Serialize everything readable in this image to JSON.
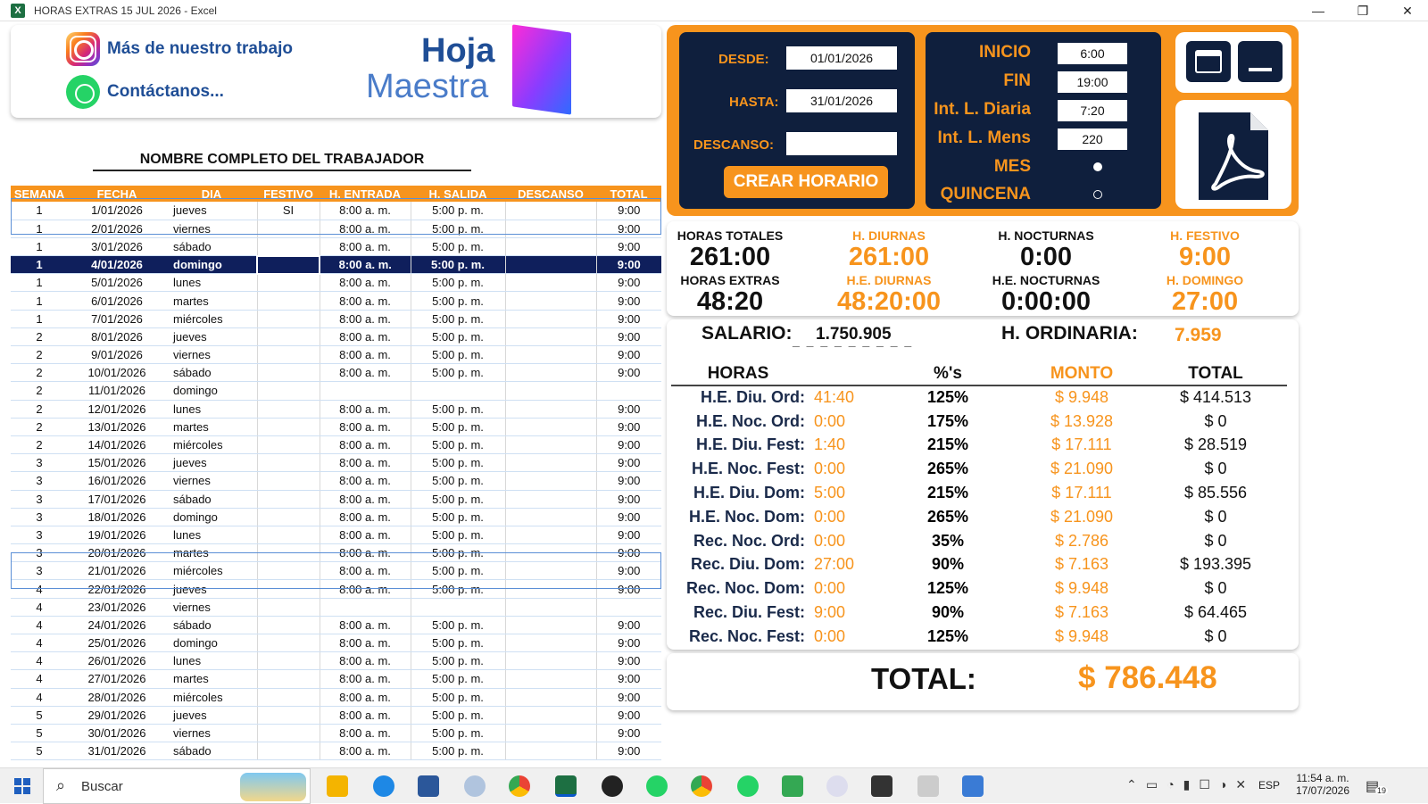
{
  "window": {
    "title": "HORAS EXTRAS 15 JUL 2026 - Excel",
    "min": "—",
    "max": "❐",
    "close": "✕",
    "app_icon": "X"
  },
  "links": {
    "instagram": "Más de nuestro trabajo",
    "whatsapp": "Contáctanos..."
  },
  "logo": {
    "line1": "Hoja",
    "line2": "Maestra"
  },
  "worker_name": "NOMBRE COMPLETO DEL TRABAJADOR",
  "table": {
    "headers": [
      "SEMANA",
      "FECHA",
      "DIA",
      "FESTIVO",
      "H. ENTRADA",
      "H. SALIDA",
      "DESCANSO",
      "TOTAL"
    ],
    "rows": [
      [
        "1",
        "1/01/2026",
        "jueves",
        "SI",
        "8:00 a. m.",
        "5:00 p. m.",
        "",
        "9:00"
      ],
      [
        "1",
        "2/01/2026",
        "viernes",
        "",
        "8:00 a. m.",
        "5:00 p. m.",
        "",
        "9:00"
      ],
      [
        "1",
        "3/01/2026",
        "sábado",
        "",
        "8:00 a. m.",
        "5:00 p. m.",
        "",
        "9:00"
      ],
      [
        "1",
        "4/01/2026",
        "domingo",
        "",
        "8:00 a. m.",
        "5:00 p. m.",
        "",
        "9:00"
      ],
      [
        "1",
        "5/01/2026",
        "lunes",
        "",
        "8:00 a. m.",
        "5:00 p. m.",
        "",
        "9:00"
      ],
      [
        "1",
        "6/01/2026",
        "martes",
        "",
        "8:00 a. m.",
        "5:00 p. m.",
        "",
        "9:00"
      ],
      [
        "1",
        "7/01/2026",
        "miércoles",
        "",
        "8:00 a. m.",
        "5:00 p. m.",
        "",
        "9:00"
      ],
      [
        "2",
        "8/01/2026",
        "jueves",
        "",
        "8:00 a. m.",
        "5:00 p. m.",
        "",
        "9:00"
      ],
      [
        "2",
        "9/01/2026",
        "viernes",
        "",
        "8:00 a. m.",
        "5:00 p. m.",
        "",
        "9:00"
      ],
      [
        "2",
        "10/01/2026",
        "sábado",
        "",
        "8:00 a. m.",
        "5:00 p. m.",
        "",
        "9:00"
      ],
      [
        "2",
        "11/01/2026",
        "domingo",
        "",
        "",
        "",
        "",
        ""
      ],
      [
        "2",
        "12/01/2026",
        "lunes",
        "",
        "8:00 a. m.",
        "5:00 p. m.",
        "",
        "9:00"
      ],
      [
        "2",
        "13/01/2026",
        "martes",
        "",
        "8:00 a. m.",
        "5:00 p. m.",
        "",
        "9:00"
      ],
      [
        "2",
        "14/01/2026",
        "miércoles",
        "",
        "8:00 a. m.",
        "5:00 p. m.",
        "",
        "9:00"
      ],
      [
        "3",
        "15/01/2026",
        "jueves",
        "",
        "8:00 a. m.",
        "5:00 p. m.",
        "",
        "9:00"
      ],
      [
        "3",
        "16/01/2026",
        "viernes",
        "",
        "8:00 a. m.",
        "5:00 p. m.",
        "",
        "9:00"
      ],
      [
        "3",
        "17/01/2026",
        "sábado",
        "",
        "8:00 a. m.",
        "5:00 p. m.",
        "",
        "9:00"
      ],
      [
        "3",
        "18/01/2026",
        "domingo",
        "",
        "8:00 a. m.",
        "5:00 p. m.",
        "",
        "9:00"
      ],
      [
        "3",
        "19/01/2026",
        "lunes",
        "",
        "8:00 a. m.",
        "5:00 p. m.",
        "",
        "9:00"
      ],
      [
        "3",
        "20/01/2026",
        "martes",
        "",
        "8:00 a. m.",
        "5:00 p. m.",
        "",
        "9:00"
      ],
      [
        "3",
        "21/01/2026",
        "miércoles",
        "",
        "8:00 a. m.",
        "5:00 p. m.",
        "",
        "9:00"
      ],
      [
        "4",
        "22/01/2026",
        "jueves",
        "",
        "8:00 a. m.",
        "5:00 p. m.",
        "",
        "9:00"
      ],
      [
        "4",
        "23/01/2026",
        "viernes",
        "",
        "",
        "",
        "",
        ""
      ],
      [
        "4",
        "24/01/2026",
        "sábado",
        "",
        "8:00 a. m.",
        "5:00 p. m.",
        "",
        "9:00"
      ],
      [
        "4",
        "25/01/2026",
        "domingo",
        "",
        "8:00 a. m.",
        "5:00 p. m.",
        "",
        "9:00"
      ],
      [
        "4",
        "26/01/2026",
        "lunes",
        "",
        "8:00 a. m.",
        "5:00 p. m.",
        "",
        "9:00"
      ],
      [
        "4",
        "27/01/2026",
        "martes",
        "",
        "8:00 a. m.",
        "5:00 p. m.",
        "",
        "9:00"
      ],
      [
        "4",
        "28/01/2026",
        "miércoles",
        "",
        "8:00 a. m.",
        "5:00 p. m.",
        "",
        "9:00"
      ],
      [
        "5",
        "29/01/2026",
        "jueves",
        "",
        "8:00 a. m.",
        "5:00 p. m.",
        "",
        "9:00"
      ],
      [
        "5",
        "30/01/2026",
        "viernes",
        "",
        "8:00 a. m.",
        "5:00 p. m.",
        "",
        "9:00"
      ],
      [
        "5",
        "31/01/2026",
        "sábado",
        "",
        "8:00 a. m.",
        "5:00 p. m.",
        "",
        "9:00"
      ]
    ],
    "selected_row": 3
  },
  "form": {
    "desde_label": "DESDE:",
    "desde": "01/01/2026",
    "hasta_label": "HASTA:",
    "hasta": "31/01/2026",
    "descanso_label": "DESCANSO:",
    "descanso": "",
    "create_button": "CREAR HORARIO"
  },
  "params": {
    "inicio_label": "INICIO",
    "inicio": "6:00",
    "fin_label": "FIN",
    "fin": "19:00",
    "intd_label": "Int. L. Diaria",
    "intd": "7:20",
    "intm_label": "Int. L. Mens",
    "intm": "220",
    "mes_label": "MES",
    "quincena_label": "QUINCENA",
    "selected": "MES"
  },
  "stats": [
    {
      "label": "HORAS TOTALES",
      "value": "261:00",
      "color": "black"
    },
    {
      "label": "H. DIURNAS",
      "value": "261:00",
      "color": "orange"
    },
    {
      "label": "H. NOCTURNAS",
      "value": "0:00",
      "color": "black"
    },
    {
      "label": "H. FESTIVO",
      "value": "9:00",
      "color": "orange"
    },
    {
      "label": "HORAS EXTRAS",
      "value": "48:20",
      "color": "black"
    },
    {
      "label": "H.E. DIURNAS",
      "value": "48:20:00",
      "color": "orange"
    },
    {
      "label": "H.E. NOCTURNAS",
      "value": "0:00:00",
      "color": "black"
    },
    {
      "label": "H. DOMINGO",
      "value": "27:00",
      "color": "orange"
    }
  ],
  "salary": {
    "label": "SALARIO:",
    "value": "1.750.905",
    "underline": "_ _ _ _ _ _ _ _ _",
    "hora_label": "H. ORDINARIA:",
    "hora": "7.959"
  },
  "hours_table": {
    "headers": [
      "HORAS",
      "",
      "%'s",
      "MONTO",
      "TOTAL"
    ],
    "rows": [
      [
        "H.E. Diu. Ord:",
        "41:40",
        "125%",
        "$ 9.948",
        "$ 414.513"
      ],
      [
        "H.E. Noc. Ord:",
        "0:00",
        "175%",
        "$ 13.928",
        "$ 0"
      ],
      [
        "H.E. Diu. Fest:",
        "1:40",
        "215%",
        "$ 17.111",
        "$ 28.519"
      ],
      [
        "H.E. Noc. Fest:",
        "0:00",
        "265%",
        "$ 21.090",
        "$ 0"
      ],
      [
        "H.E. Diu. Dom:",
        "5:00",
        "215%",
        "$ 17.111",
        "$ 85.556"
      ],
      [
        "H.E. Noc. Dom:",
        "0:00",
        "265%",
        "$ 21.090",
        "$ 0"
      ],
      [
        "Rec. Noc. Ord:",
        "0:00",
        "35%",
        "$ 2.786",
        "$ 0"
      ],
      [
        "Rec. Diu. Dom:",
        "27:00",
        "90%",
        "$ 7.163",
        "$ 193.395"
      ],
      [
        "Rec. Noc. Dom:",
        "0:00",
        "125%",
        "$ 9.948",
        "$ 0"
      ],
      [
        "Rec. Diu. Fest:",
        "9:00",
        "90%",
        "$ 7.163",
        "$ 64.465"
      ],
      [
        "Rec. Noc. Fest:",
        "0:00",
        "125%",
        "$ 9.948",
        "$ 0"
      ]
    ]
  },
  "total": {
    "label": "TOTAL:",
    "value": "$ 786.448"
  },
  "taskbar": {
    "search": "Buscar",
    "lang": "ESP",
    "time": "11:54 a. m.",
    "date": "17/07/2026",
    "notif": "19"
  },
  "colors": {
    "orange": "#f7941d",
    "navy": "#0f1f3d"
  }
}
